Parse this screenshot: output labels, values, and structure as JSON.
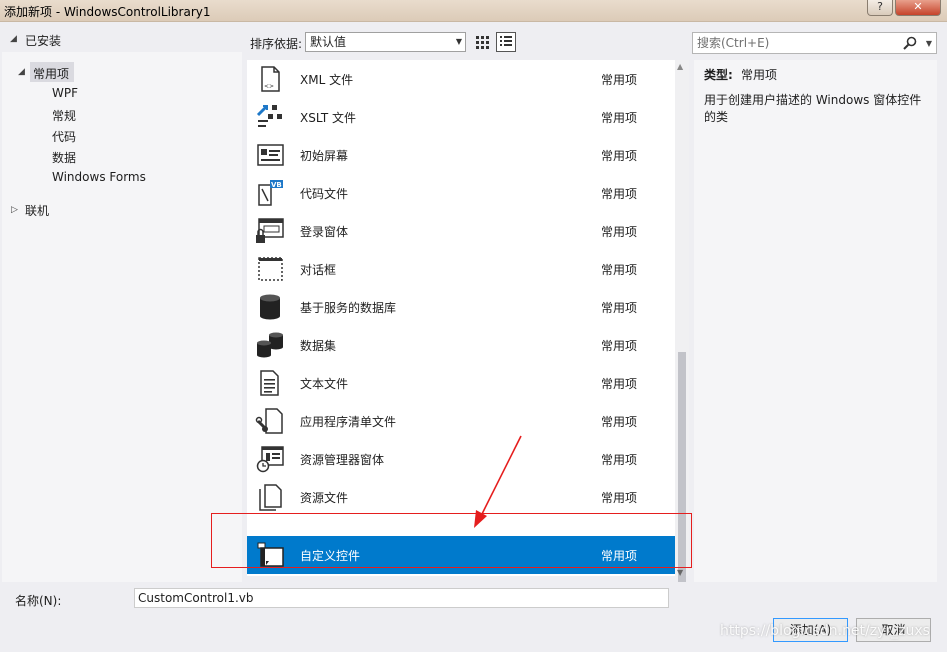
{
  "window": {
    "title": "添加新项 - WindowsControlLibrary1",
    "help_label": "?",
    "close_label": "✕"
  },
  "tree": {
    "installed_label": "已安装",
    "common_label": "常用项",
    "children": [
      "WPF",
      "常规",
      "代码",
      "数据",
      "Windows Forms"
    ],
    "online_label": "联机"
  },
  "toolbar": {
    "sort_label": "排序依据:",
    "sort_value": "默认值"
  },
  "search": {
    "placeholder": "搜索(Ctrl+E)"
  },
  "items": [
    {
      "name": "XML 文件",
      "category": "常用项",
      "icon": "xml-file-icon"
    },
    {
      "name": "XSLT 文件",
      "category": "常用项",
      "icon": "xslt-file-icon"
    },
    {
      "name": "初始屏幕",
      "category": "常用项",
      "icon": "splash-screen-icon"
    },
    {
      "name": "代码文件",
      "category": "常用项",
      "icon": "code-file-icon"
    },
    {
      "name": "登录窗体",
      "category": "常用项",
      "icon": "login-form-icon"
    },
    {
      "name": "对话框",
      "category": "常用项",
      "icon": "dialog-icon"
    },
    {
      "name": "基于服务的数据库",
      "category": "常用项",
      "icon": "database-icon"
    },
    {
      "name": "数据集",
      "category": "常用项",
      "icon": "dataset-icon"
    },
    {
      "name": "文本文件",
      "category": "常用项",
      "icon": "text-file-icon"
    },
    {
      "name": "应用程序清单文件",
      "category": "常用项",
      "icon": "manifest-file-icon"
    },
    {
      "name": "资源管理器窗体",
      "category": "常用项",
      "icon": "explorer-form-icon"
    },
    {
      "name": "资源文件",
      "category": "常用项",
      "icon": "resource-file-icon"
    },
    {
      "name": "自定义控件",
      "category": "常用项",
      "icon": "custom-control-icon",
      "selected": true
    }
  ],
  "description": {
    "type_label": "类型:",
    "type_value": "常用项",
    "text": "用于创建用户描述的 Windows 窗体控件的类"
  },
  "footer": {
    "name_label": "名称(N):",
    "name_value": "CustomControl1.vb",
    "add_label": "添加(A)",
    "cancel_label": "取消"
  },
  "watermark": "https://blog.csdn.net/zyr_zuxs",
  "colors": {
    "selection": "#007acc",
    "annotation": "#e51e1e"
  }
}
